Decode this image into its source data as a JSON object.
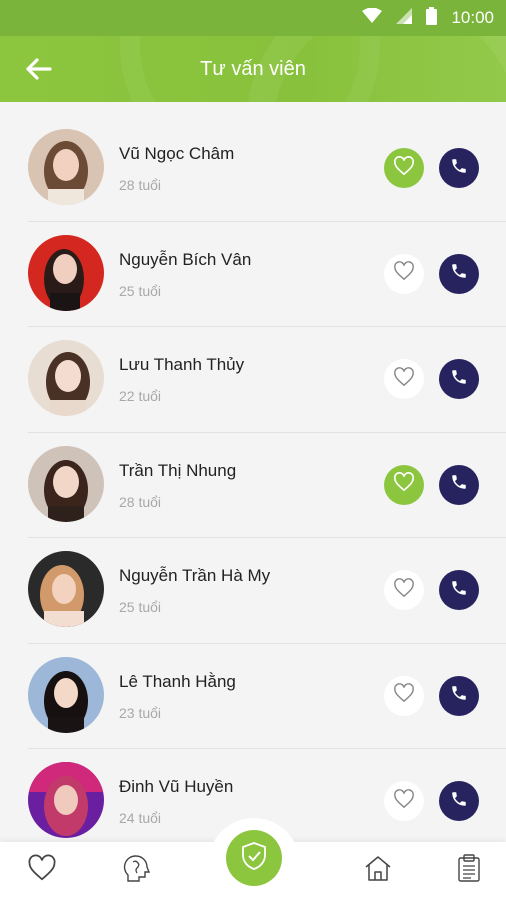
{
  "status_bar": {
    "time": "10:00",
    "icons": [
      "wifi-icon",
      "signal-icon",
      "battery-icon"
    ]
  },
  "header": {
    "title": "Tư vấn viên",
    "back_icon": "arrow-left-icon"
  },
  "colors": {
    "accent": "#8cc63f",
    "call": "#26235f",
    "age": "#a8a8a8"
  },
  "advisors": [
    {
      "name": "Vũ Ngọc Châm",
      "age": "28 tuổi",
      "favorite": true
    },
    {
      "name": "Nguyễn Bích Vân",
      "age": "25 tuổi",
      "favorite": false
    },
    {
      "name": "Lưu Thanh Thủy",
      "age": "22 tuổi",
      "favorite": false
    },
    {
      "name": "Trần Thị Nhung",
      "age": "28 tuổi",
      "favorite": true
    },
    {
      "name": "Nguyễn Trần Hà My",
      "age": "25 tuổi",
      "favorite": false
    },
    {
      "name": "Lê Thanh Hằng",
      "age": "23 tuổi",
      "favorite": false
    },
    {
      "name": "Đinh Vũ Huyền",
      "age": "24 tuổi",
      "favorite": false
    }
  ],
  "bottom_nav": {
    "items": [
      "heart-icon",
      "head-brain-icon",
      "shield-check-icon",
      "home-icon",
      "clipboard-icon"
    ]
  }
}
